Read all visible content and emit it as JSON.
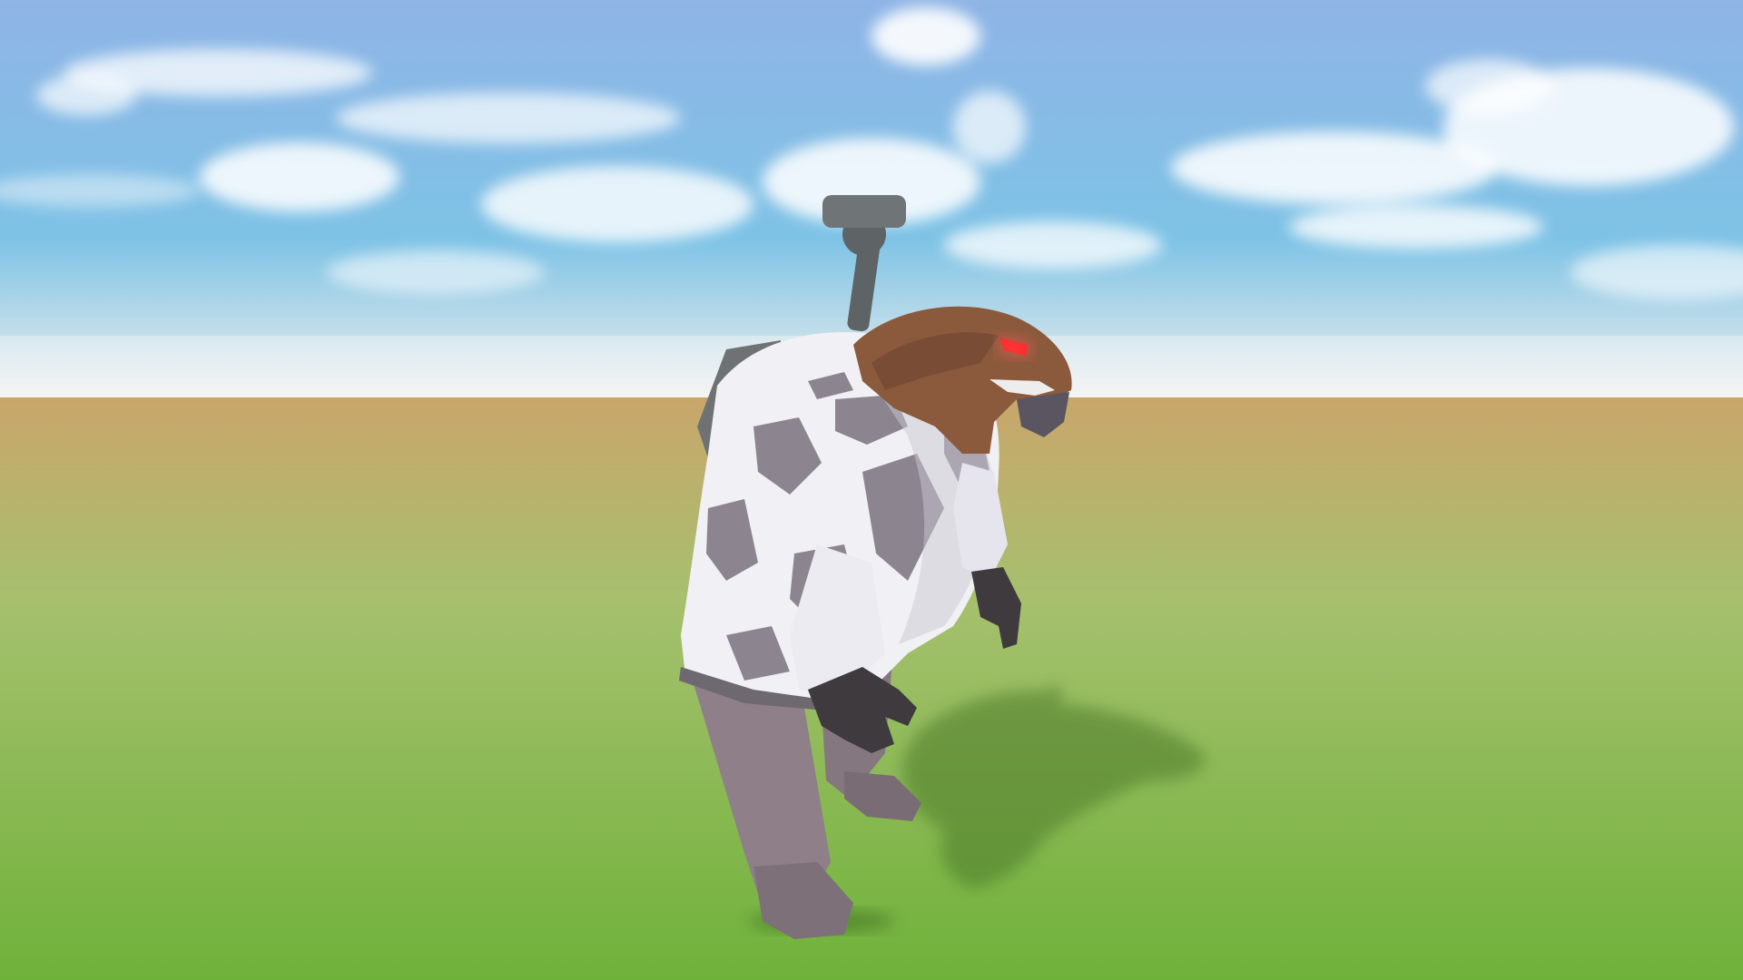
{
  "scene": {
    "colors": {
      "sky_top": "#8FB4E6",
      "sky_mid": "#7EC3E6",
      "sky_horizon": "#F2F0EC",
      "ground_far": "#C9A66B",
      "ground_mid": "#A6C06E",
      "ground_near": "#6FB23A",
      "cloud": "#FFFFFF",
      "shadow": "#4E7A2C",
      "coat_white": "#F1F0F5",
      "coat_camo": "#8C8590",
      "pants": "#8E7F88",
      "head": "#8B5A3C",
      "skin_dark": "#3E3A3E",
      "eye": "#FF1A1A",
      "backpack": "#6F7273",
      "antenna": "#5E6366"
    },
    "character": {
      "eye_color_name": "red"
    }
  }
}
